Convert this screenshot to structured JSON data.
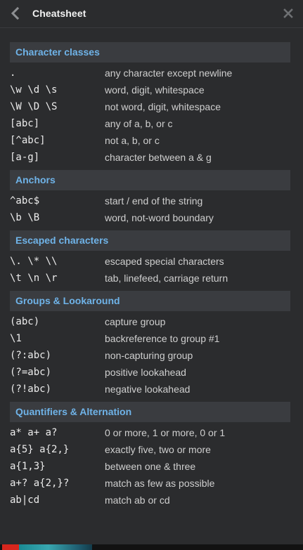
{
  "header": {
    "title": "Cheatsheet",
    "back_icon": "chevron-left-icon",
    "close_icon": "close-icon"
  },
  "colors": {
    "background": "#2b2c2e",
    "section_bg": "#3a3c40",
    "section_title": "#6fb3e8"
  },
  "sections": [
    {
      "title": "Character classes",
      "rows": [
        {
          "code": ".",
          "desc": "any character except newline"
        },
        {
          "code": "\\w \\d \\s",
          "desc": "word, digit, whitespace"
        },
        {
          "code": "\\W \\D \\S",
          "desc": "not word, digit, whitespace"
        },
        {
          "code": "[abc]",
          "desc": "any of a, b, or c"
        },
        {
          "code": "[^abc]",
          "desc": "not a, b, or c"
        },
        {
          "code": "[a-g]",
          "desc": "character between a & g"
        }
      ]
    },
    {
      "title": "Anchors",
      "rows": [
        {
          "code": "^abc$",
          "desc": "start / end of the string"
        },
        {
          "code": "\\b \\B",
          "desc": "word, not-word boundary"
        }
      ]
    },
    {
      "title": "Escaped characters",
      "rows": [
        {
          "code": "\\. \\* \\\\",
          "desc": "escaped special characters"
        },
        {
          "code": "\\t \\n \\r",
          "desc": "tab, linefeed, carriage return"
        }
      ]
    },
    {
      "title": "Groups & Lookaround",
      "rows": [
        {
          "code": "(abc)",
          "desc": "capture group"
        },
        {
          "code": "\\1",
          "desc": "backreference to group #1"
        },
        {
          "code": "(?:abc)",
          "desc": "non-capturing group"
        },
        {
          "code": "(?=abc)",
          "desc": "positive lookahead"
        },
        {
          "code": "(?!abc)",
          "desc": "negative lookahead"
        }
      ]
    },
    {
      "title": "Quantifiers & Alternation",
      "rows": [
        {
          "code": "a* a+ a?",
          "desc": "0 or more, 1 or more, 0 or 1"
        },
        {
          "code": "a{5} a{2,}",
          "desc": "exactly five, two or more"
        },
        {
          "code": "a{1,3}",
          "desc": "between one & three"
        },
        {
          "code": "a+? a{2,}?",
          "desc": "match as few as possible"
        },
        {
          "code": "ab|cd",
          "desc": "match ab or cd"
        }
      ]
    }
  ]
}
